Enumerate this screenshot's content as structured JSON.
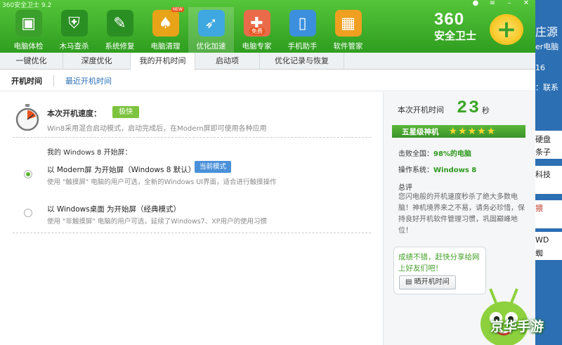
{
  "window": {
    "title": "360安全卫士 9.2"
  },
  "toolbar": {
    "items": [
      {
        "label": "电脑体检",
        "icon": "monitor-check-icon",
        "color": "#3b9f2b"
      },
      {
        "label": "木马查杀",
        "icon": "horse-shield-icon",
        "color": "#2a8f23"
      },
      {
        "label": "系统修复",
        "icon": "wrench-icon",
        "color": "#2a8f23"
      },
      {
        "label": "电脑清理",
        "icon": "broom-icon",
        "color": "#e8a319",
        "badge": "NEW"
      },
      {
        "label": "优化加速",
        "icon": "rocket-icon",
        "color": "#3fa8e0"
      },
      {
        "label": "电脑专家",
        "icon": "doctor-icon",
        "color": "#e96b4a",
        "badge": "免费"
      },
      {
        "label": "手机助手",
        "icon": "phone-icon",
        "color": "#3c8fdc"
      },
      {
        "label": "软件管家",
        "icon": "apps-grid-icon",
        "color": "#f0a020"
      }
    ],
    "active_index": 4
  },
  "logo": {
    "number": "360",
    "text": "安全卫士",
    "symbol": "+"
  },
  "tabs": [
    {
      "label": "一键优化"
    },
    {
      "label": "深度优化"
    },
    {
      "label": "我的开机时间"
    },
    {
      "label": "启动项"
    },
    {
      "label": "优化记录与恢复"
    }
  ],
  "subtabs": {
    "active": "开机时间",
    "link": "最近开机时间"
  },
  "speed": {
    "label": "本次开机速度：",
    "badge": "极快",
    "desc": "Win8采用混合启动模式，启动完成后，在Modern屏即可使用各种应用"
  },
  "start_screen": {
    "heading": "我的 Windows 8 开始屏：",
    "options": [
      {
        "title": "以 Modern屏 为开始屏（Windows 8 默认）",
        "desc": "使用 \"触摸屏\" 电脑的用户可选，全新的Windows UI界面，适合进行触摸操作",
        "selected": true,
        "badge": "当前模式"
      },
      {
        "title": "以 Windows桌面 为开始屏（经典模式）",
        "desc": "使用 \"非触摸屏\" 电脑的用户可选，延续了Windows7、XP用户的使用习惯",
        "selected": false
      }
    ]
  },
  "boot": {
    "label": "本次开机时间",
    "seconds": "23",
    "unit": "秒",
    "rank": "五星级神机",
    "stars": 5,
    "beat_label": "击败全国：",
    "beat_value": "98%的电脑",
    "os_label": "操作系统：",
    "os_value": "Windows 8",
    "summary_title": "总评",
    "summary_text": "您闪电般的开机速度秒杀了绝大多数电脑！神机境界来之不易，请务必珍惜，保持良好开机软件管理习惯，巩固巅峰地位！"
  },
  "share": {
    "text": "成绩不错，赶快分享给网上好友们吧！",
    "button": "晒开机时间"
  },
  "background_app": {
    "lines": [
      "庄源",
      "er电脑",
      "16",
      "：联系",
      "硬盘",
      "条子",
      "科技",
      "猥",
      "取",
      "WD",
      "蜘"
    ]
  },
  "watermark": "京华手游"
}
